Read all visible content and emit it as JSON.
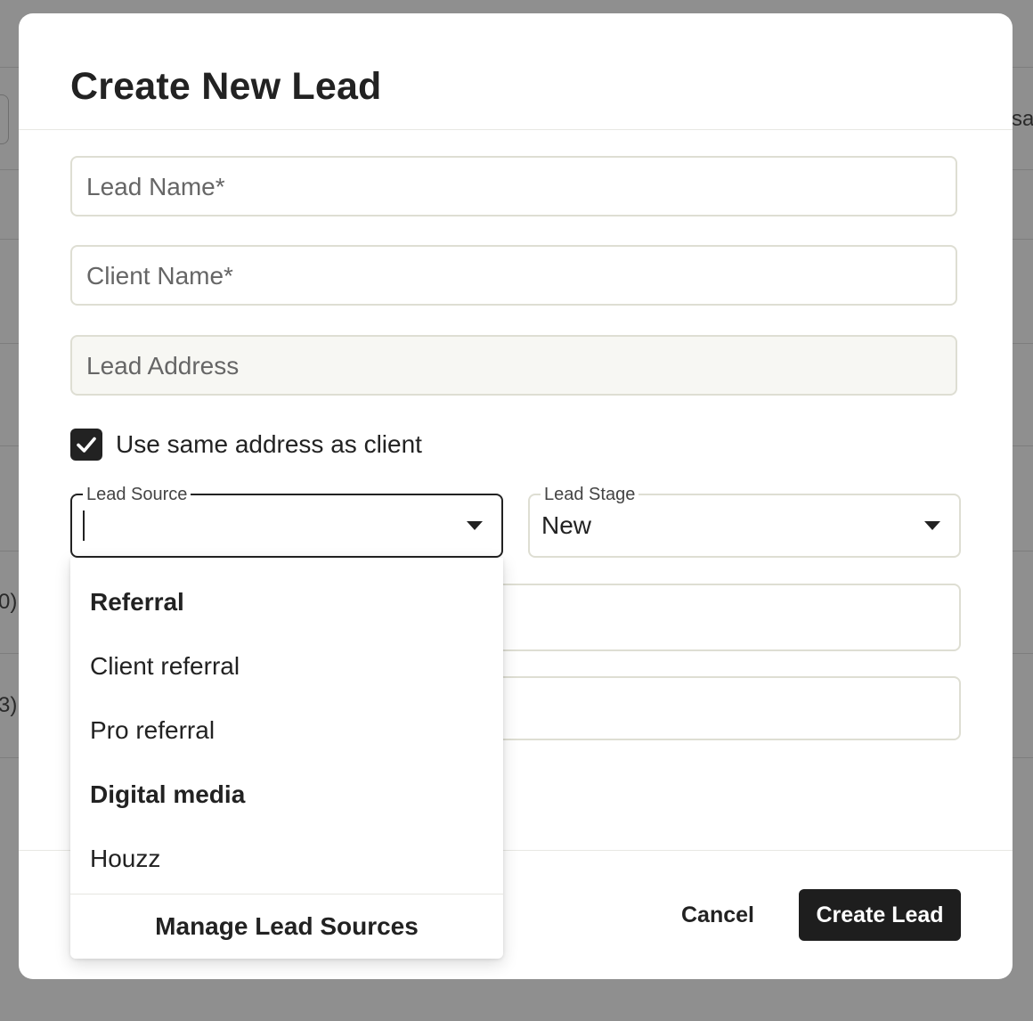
{
  "background": {
    "partial_text_right": "sag",
    "partial_row_1": "0)",
    "partial_row_2": "3)"
  },
  "modal": {
    "title": "Create New Lead"
  },
  "form": {
    "lead_name": {
      "value": "",
      "placeholder": "Lead Name*"
    },
    "client_name": {
      "value": "",
      "placeholder": "Client Name*"
    },
    "lead_address": {
      "value": "",
      "placeholder": "Lead Address"
    },
    "same_address": {
      "label": "Use same address as client",
      "checked": true
    },
    "lead_source": {
      "legend": "Lead Source",
      "value": ""
    },
    "lead_stage": {
      "legend": "Lead Stage",
      "value": "New"
    }
  },
  "dropdown": {
    "items": [
      {
        "label": "Referral",
        "type": "group"
      },
      {
        "label": "Client referral",
        "type": "option"
      },
      {
        "label": "Pro referral",
        "type": "option"
      },
      {
        "label": "Digital media",
        "type": "group"
      },
      {
        "label": "Houzz",
        "type": "option"
      }
    ],
    "manage_label": "Manage Lead Sources"
  },
  "footer": {
    "cancel_label": "Cancel",
    "create_label": "Create Lead"
  },
  "colors": {
    "primary_button": "#1e1e1e",
    "field_border": "#deded3",
    "backdrop": "#8f8f8f"
  }
}
